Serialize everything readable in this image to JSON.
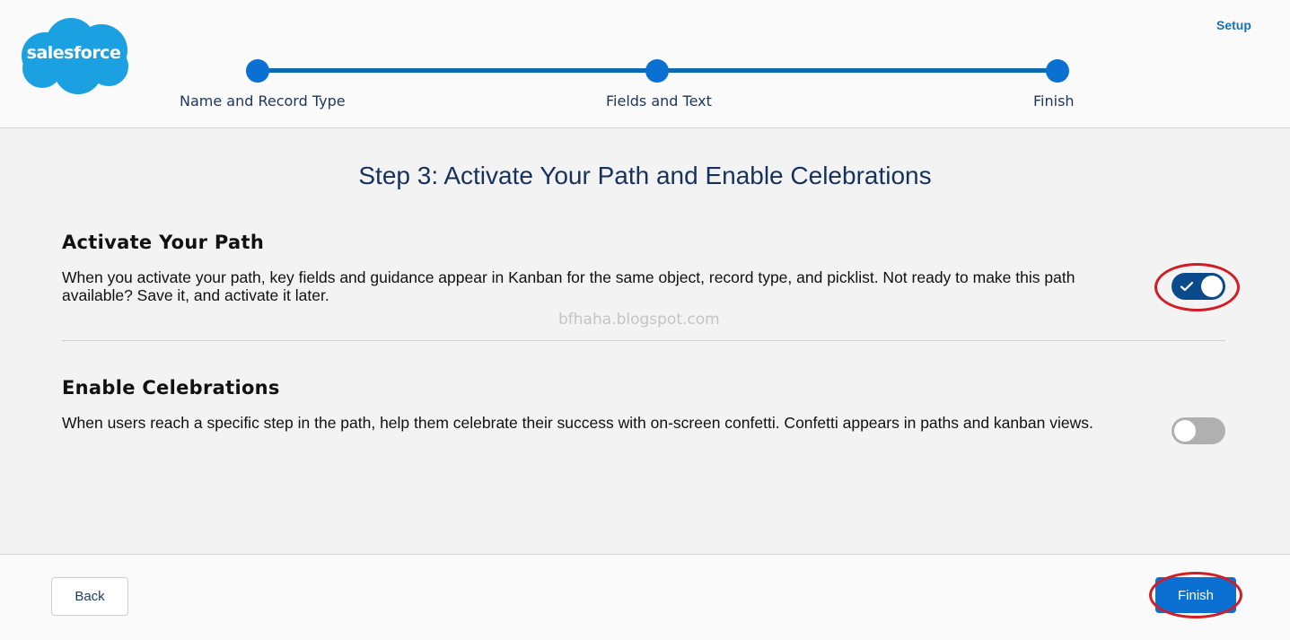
{
  "brand": {
    "logo_text": "salesforce",
    "logo_color": "#1ba1e2"
  },
  "header": {
    "setup_link": "Setup"
  },
  "path_steps": [
    {
      "label": "Name and Record Type"
    },
    {
      "label": "Fields and Text"
    },
    {
      "label": "Finish"
    }
  ],
  "step_title": "Step 3: Activate Your Path and Enable Celebrations",
  "activate": {
    "title": "Activate Your Path",
    "description": "When you activate your path, key fields and guidance appear in Kanban for the same object, record type, and picklist. Not ready to make this path available? Save it, and activate it later.",
    "toggle_on": true
  },
  "watermark": "bfhaha.blogspot.com",
  "celebrations": {
    "title": "Enable Celebrations",
    "description": "When users reach a specific step in the path, help them celebrate their success with on-screen confetti. Confetti appears in paths and kanban views.",
    "toggle_on": false
  },
  "footer": {
    "back_label": "Back",
    "finish_label": "Finish"
  },
  "colors": {
    "accent": "#0b70d2",
    "toggle_on": "#0b4a8b",
    "highlight": "#d21d25"
  }
}
